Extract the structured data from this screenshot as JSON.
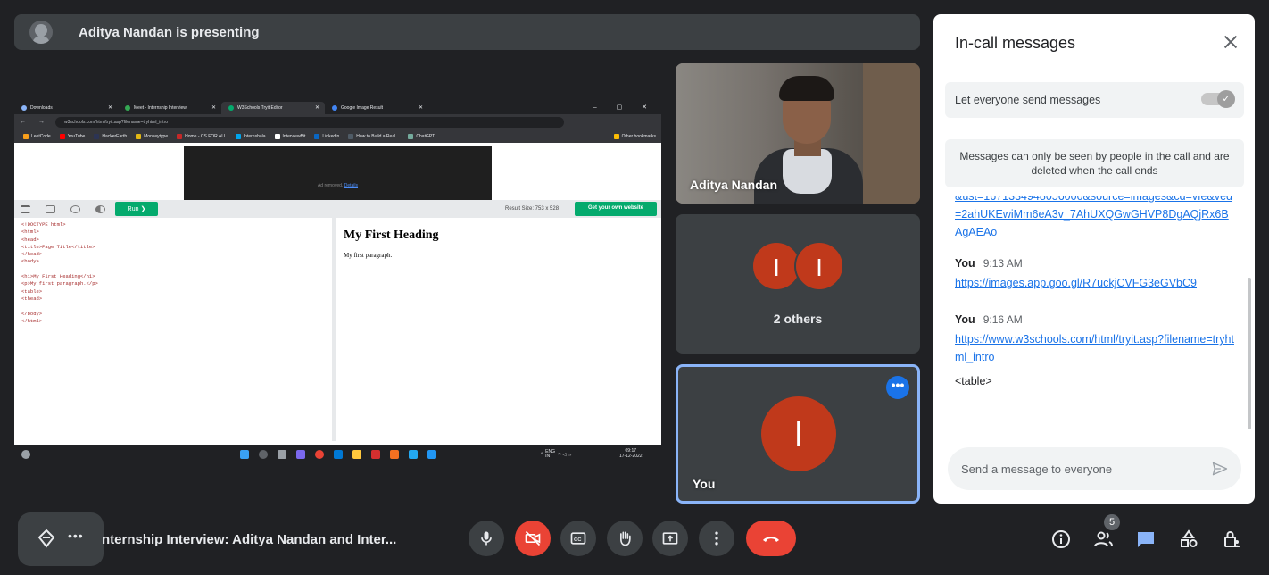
{
  "presenting": {
    "title": "Aditya Nandan is presenting"
  },
  "shared_screen": {
    "tabs": [
      "Downloads",
      "Meet - Internship Interview",
      "W3Schools Tryit Editor",
      "Google Image Result"
    ],
    "url": "w3schools.com/html/tryit.asp?filename=tryhtml_intro",
    "bookmarks": [
      "LeetCode",
      "YouTube",
      "HackerEarth",
      "Monkeytype",
      "Home - CS FOR ALL",
      "Internshala",
      "InterviewBit",
      "LinkedIn",
      "How to Build a Real...",
      "ChatGPT"
    ],
    "other_bookmarks": "Other bookmarks",
    "ad_removed": "Ad removed.",
    "ad_details": "Details",
    "run_label": "Run ❯",
    "result_size": "Result Size: 753 x 528",
    "own_site": "Get your own website",
    "code_lines": [
      "<!DOCTYPE html>",
      "<html>",
      "<head>",
      "<title>Page Title</title>",
      "</head>",
      "<body>",
      "",
      "<h1>My First Heading</h1>",
      "<p>My first paragraph.</p>",
      "<table>",
      "<thead>",
      "",
      "</body>",
      "</html>"
    ],
    "result_heading": "My First Heading",
    "result_paragraph": "My first paragraph.",
    "tray_lang": "ENG\nIN",
    "tray_time": "09:17",
    "tray_date": "17-12-2022"
  },
  "tiles": {
    "camera_name": "Aditya Nandan",
    "others_initial_1": "I",
    "others_initial_2": "I",
    "others_label": "2 others",
    "you_initial": "I",
    "you_label": "You"
  },
  "chat": {
    "title": "In-call messages",
    "setting_label": "Let everyone send messages",
    "setting_on": true,
    "notice": "Messages can only be seen by people in the call and are deleted when the call ends",
    "partial_link": "&ust=1671334948056000&source=images&cd=vfe&ved=2ahUKEwiMm6eA3v_7AhUXQGwGHVP8DgAQjRx6BAgAEAo",
    "messages": [
      {
        "sender": "You",
        "time": "9:13 AM",
        "link": "https://images.app.goo.gl/R7uckjCVFG3eGVbC9"
      },
      {
        "sender": "You",
        "time": "9:16 AM",
        "link": "https://www.w3schools.com/html/tryit.asp?filename=tryhtml_intro",
        "text": "<table>"
      }
    ],
    "input_placeholder": "Send a message to everyone"
  },
  "bottom": {
    "meeting_name": "nternship Interview: Aditya Nandan and Inter...",
    "participants_count": "5"
  },
  "colors": {
    "accent_blue": "#1a73e8",
    "danger_red": "#ea4335",
    "avatar_red": "#c0391b",
    "bg": "#202124"
  }
}
